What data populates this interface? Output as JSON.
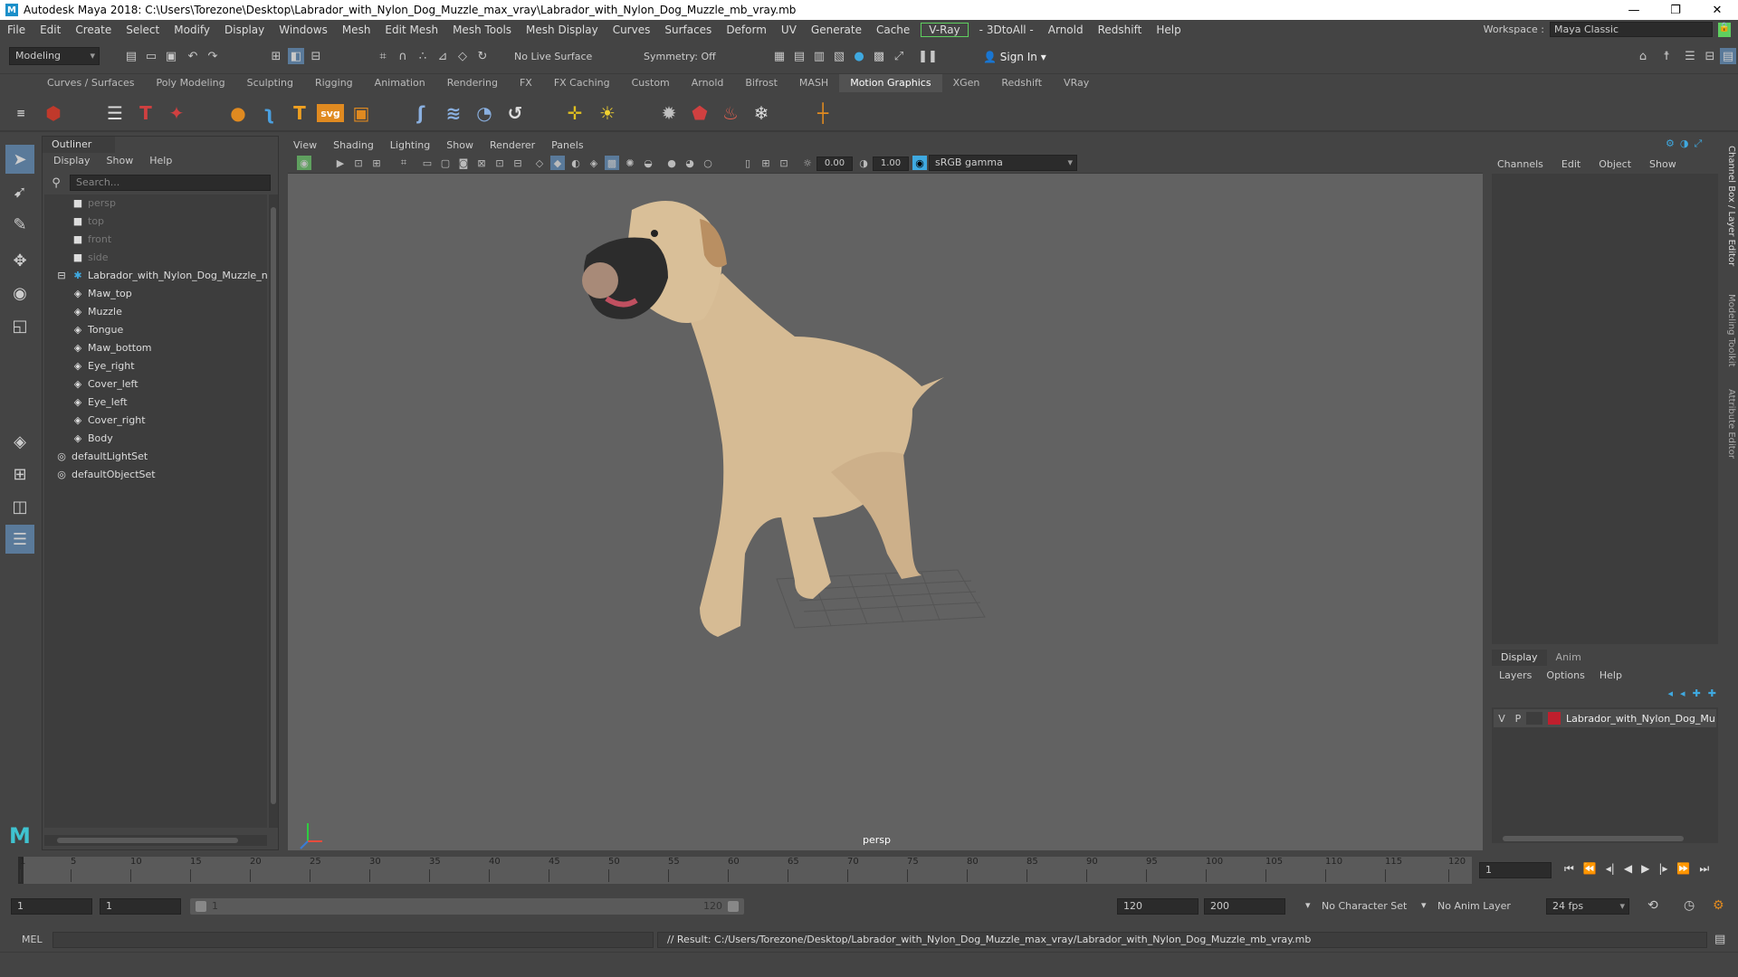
{
  "window": {
    "title": "Autodesk Maya 2018: C:\\Users\\Torezone\\Desktop\\Labrador_with_Nylon_Dog_Muzzle_max_vray\\Labrador_with_Nylon_Dog_Muzzle_mb_vray.mb",
    "minimize": "—",
    "restore": "❐",
    "close": "✕"
  },
  "menubar": {
    "items": [
      "File",
      "Edit",
      "Create",
      "Select",
      "Modify",
      "Display",
      "Windows",
      "Mesh",
      "Edit Mesh",
      "Mesh Tools",
      "Mesh Display",
      "Curves",
      "Surfaces",
      "Deform",
      "UV",
      "Generate",
      "Cache"
    ],
    "vray": "V-Ray",
    "items2": [
      "- 3DtoAll -",
      "Arnold",
      "Redshift",
      "Help"
    ],
    "workspace_label": "Workspace :",
    "workspace_value": "Maya Classic"
  },
  "statusline": {
    "mode": "Modeling",
    "live_surface": "No Live Surface",
    "symmetry": "Symmetry: Off",
    "sign_in": "Sign In"
  },
  "shelf_tabs": [
    "Curves / Surfaces",
    "Poly Modeling",
    "Sculpting",
    "Rigging",
    "Animation",
    "Rendering",
    "FX",
    "FX Caching",
    "Custom",
    "Arnold",
    "Bifrost",
    "MASH",
    "Motion Graphics",
    "XGen",
    "Redshift",
    "VRay"
  ],
  "shelf_active": "Motion Graphics",
  "outliner": {
    "title": "Outliner",
    "menu": [
      "Display",
      "Show",
      "Help"
    ],
    "search_placeholder": "Search...",
    "cameras": [
      "persp",
      "top",
      "front",
      "side"
    ],
    "group": "Labrador_with_Nylon_Dog_Muzzle_n",
    "meshes": [
      "Maw_top",
      "Muzzle",
      "Tongue",
      "Maw_bottom",
      "Eye_right",
      "Cover_left",
      "Eye_left",
      "Cover_right",
      "Body"
    ],
    "sets": [
      "defaultLightSet",
      "defaultObjectSet"
    ]
  },
  "viewport": {
    "menu": [
      "View",
      "Shading",
      "Lighting",
      "Show",
      "Renderer",
      "Panels"
    ],
    "exposure": "0.00",
    "gamma": "1.00",
    "color_space": "sRGB gamma",
    "camera": "persp"
  },
  "channel_box": {
    "menu": [
      "Channels",
      "Edit",
      "Object",
      "Show"
    ],
    "side_tabs": [
      "Channel Box / Layer Editor",
      "Modeling Toolkit",
      "Attribute Editor"
    ]
  },
  "layer_editor": {
    "tabs": [
      "Display",
      "Anim"
    ],
    "menu": [
      "Layers",
      "Options",
      "Help"
    ],
    "layer": {
      "v": "V",
      "p": "P",
      "name": "Labrador_with_Nylon_Dog_Mu",
      "color": "#c01f2d"
    }
  },
  "timeline": {
    "ticks": [
      "1",
      "5",
      "10",
      "15",
      "20",
      "25",
      "30",
      "35",
      "40",
      "45",
      "50",
      "55",
      "60",
      "65",
      "70",
      "75",
      "80",
      "85",
      "90",
      "95",
      "100",
      "105",
      "110",
      "115",
      "120"
    ],
    "current_frame": "1"
  },
  "range": {
    "start": "1",
    "playback_start": "1",
    "bar_start": "1",
    "bar_end": "120",
    "playback_end": "120",
    "end": "200",
    "character_set": "No Character Set",
    "anim_layer": "No Anim Layer",
    "fps": "24 fps"
  },
  "command": {
    "lang": "MEL",
    "result": "// Result: C:/Users/Torezone/Desktop/Labrador_with_Nylon_Dog_Muzzle_max_vray/Labrador_with_Nylon_Dog_Muzzle_mb_vray.mb"
  }
}
